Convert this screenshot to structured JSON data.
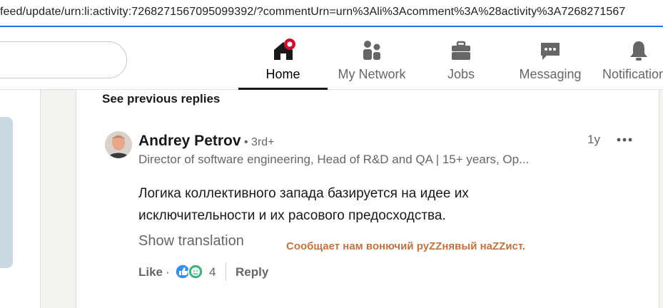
{
  "browser": {
    "url": "feed/update/urn:li:activity:7268271567095099392/?commentUrn=urn%3Ali%3Acomment%3A%28activity%3A7268271567"
  },
  "nav": {
    "items": [
      {
        "label": "Home",
        "icon": "home-icon",
        "active": true
      },
      {
        "label": "My Network",
        "icon": "network-icon"
      },
      {
        "label": "Jobs",
        "icon": "briefcase-icon"
      },
      {
        "label": "Messaging",
        "icon": "messaging-icon"
      },
      {
        "label": "Notifications",
        "icon": "bell-icon"
      }
    ],
    "accent_color": "#cb112d"
  },
  "comments": {
    "see_previous": "See previous replies"
  },
  "comment": {
    "author": "Andrey Petrov",
    "degree": "• 3rd+",
    "headline": "Director of software engineering, Head of R&D and QA | 15+ years, Op...",
    "timestamp": "1y",
    "text_line1": "Логика коллективного запада базируется на идее их",
    "text_line2": "исключительности и их расового предосходства.",
    "show_translation": "Show translation",
    "like_label": "Like",
    "dot": "·",
    "reactions_count": "4",
    "reply_label": "Reply"
  },
  "overlay": {
    "note": "Сообщает нам вонючий руZZнявый наZZист."
  }
}
